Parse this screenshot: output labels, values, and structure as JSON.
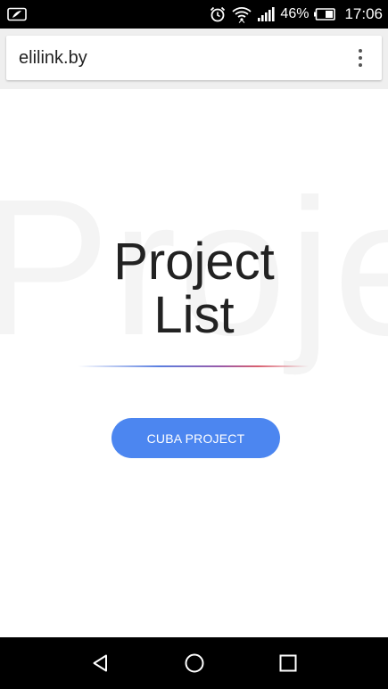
{
  "status_bar": {
    "battery_percent": "46%",
    "time": "17:06",
    "icons": [
      "notification-icon",
      "alarm-icon",
      "wifi-icon",
      "signal-icon",
      "battery-icon"
    ]
  },
  "browser": {
    "url": "elilink.by",
    "menu_icon": "more-vert-icon"
  },
  "page": {
    "background_word": "Proje",
    "title_line1": "Project",
    "title_line2": "List",
    "cta_label": "CUBA PROJECT"
  },
  "navigation": {
    "icons": [
      "back-icon",
      "home-icon",
      "recents-icon"
    ]
  },
  "colors": {
    "accent": "#4c86f0",
    "text": "#222222",
    "status_bar": "#000000"
  }
}
